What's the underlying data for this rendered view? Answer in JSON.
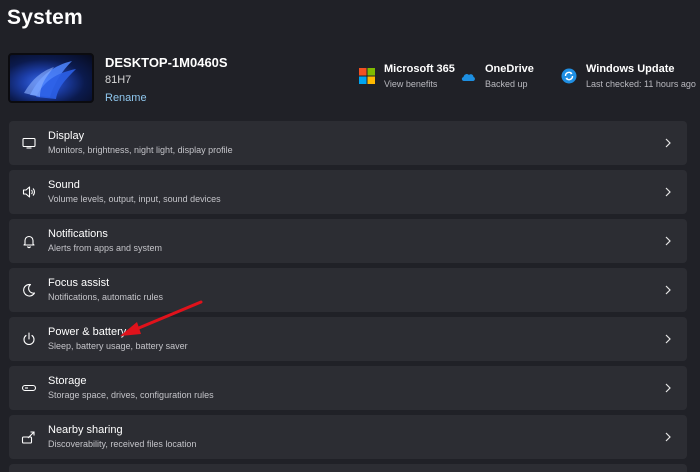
{
  "page": {
    "title": "System"
  },
  "device": {
    "name": "DESKTOP-1M0460S",
    "model": "81H7",
    "rename_label": "Rename"
  },
  "status": [
    {
      "title": "Microsoft 365",
      "subtitle": "View benefits",
      "icon": "microsoft-365-icon"
    },
    {
      "title": "OneDrive",
      "subtitle": "Backed up",
      "icon": "onedrive-cloud-icon"
    },
    {
      "title": "Windows Update",
      "subtitle": "Last checked: 11 hours ago",
      "icon": "windows-update-icon"
    }
  ],
  "settings": [
    {
      "title": "Display",
      "subtitle": "Monitors, brightness, night light, display profile",
      "icon": "display-icon"
    },
    {
      "title": "Sound",
      "subtitle": "Volume levels, output, input, sound devices",
      "icon": "speaker-icon"
    },
    {
      "title": "Notifications",
      "subtitle": "Alerts from apps and system",
      "icon": "bell-icon"
    },
    {
      "title": "Focus assist",
      "subtitle": "Notifications, automatic rules",
      "icon": "moon-icon"
    },
    {
      "title": "Power & battery",
      "subtitle": "Sleep, battery usage, battery saver",
      "icon": "power-icon"
    },
    {
      "title": "Storage",
      "subtitle": "Storage space, drives, configuration rules",
      "icon": "storage-drive-icon"
    },
    {
      "title": "Nearby sharing",
      "subtitle": "Discoverability, received files location",
      "icon": "nearby-sharing-icon"
    }
  ],
  "colors": {
    "background": "#202127",
    "card": "#2c2d33",
    "link": "#8fc7ee",
    "annotation_arrow": "#e0121b"
  }
}
